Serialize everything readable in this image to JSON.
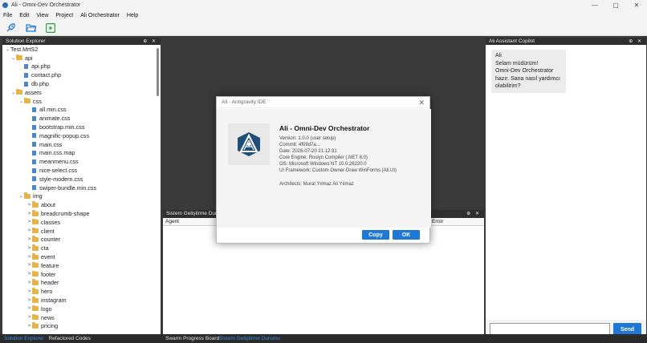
{
  "window": {
    "title": "Ali - Omni-Dev Orchestrator",
    "controls": [
      "—",
      "▢",
      "✕"
    ]
  },
  "menu": [
    "File",
    "Edit",
    "View",
    "Project",
    "Ali Orchestrator",
    "Help"
  ],
  "toolbar": {
    "icons": [
      "rocket-icon",
      "open-folder-icon",
      "run-icon"
    ],
    "accent": "#1e78d4",
    "run_color": "#2ea043"
  },
  "solution_explorer": {
    "title": "Solution Explorer",
    "header_icons": "⊕ ✕",
    "root": "Test.MrtS2",
    "rows": [
      {
        "label": "api",
        "type": "folder",
        "level": 1,
        "arrow": "⌄"
      },
      {
        "label": "api.php",
        "type": "file",
        "level": 2,
        "arrow": ""
      },
      {
        "label": "contact.php",
        "type": "file",
        "level": 2,
        "arrow": ""
      },
      {
        "label": "db.php",
        "type": "file",
        "level": 2,
        "arrow": ""
      },
      {
        "label": "assets",
        "type": "folder",
        "level": 1,
        "arrow": "⌄"
      },
      {
        "label": "css",
        "type": "folder",
        "level": 2,
        "arrow": "⌄"
      },
      {
        "label": "all.min.css",
        "type": "file",
        "level": 3,
        "arrow": ""
      },
      {
        "label": "animate.css",
        "type": "file",
        "level": 3,
        "arrow": ""
      },
      {
        "label": "bootstrap.min.css",
        "type": "file",
        "level": 3,
        "arrow": ""
      },
      {
        "label": "magnific-popup.css",
        "type": "file",
        "level": 3,
        "arrow": ""
      },
      {
        "label": "main.css",
        "type": "file",
        "level": 3,
        "arrow": ""
      },
      {
        "label": "main.css.map",
        "type": "file",
        "level": 3,
        "arrow": ""
      },
      {
        "label": "meanmenu.css",
        "type": "file",
        "level": 3,
        "arrow": ""
      },
      {
        "label": "nice-select.css",
        "type": "file",
        "level": 3,
        "arrow": ""
      },
      {
        "label": "style-modern.css",
        "type": "file",
        "level": 3,
        "arrow": ""
      },
      {
        "label": "swiper-bundle.min.css",
        "type": "file",
        "level": 3,
        "arrow": ""
      },
      {
        "label": "img",
        "type": "folder",
        "level": 2,
        "arrow": "⌄"
      },
      {
        "label": "about",
        "type": "folder",
        "level": 3,
        "arrow": ">"
      },
      {
        "label": "breadcrumb-shape",
        "type": "folder",
        "level": 3,
        "arrow": ">"
      },
      {
        "label": "classes",
        "type": "folder",
        "level": 3,
        "arrow": ">"
      },
      {
        "label": "client",
        "type": "folder",
        "level": 3,
        "arrow": ">"
      },
      {
        "label": "counter",
        "type": "folder",
        "level": 3,
        "arrow": ">"
      },
      {
        "label": "cta",
        "type": "folder",
        "level": 3,
        "arrow": ">"
      },
      {
        "label": "event",
        "type": "folder",
        "level": 3,
        "arrow": ">"
      },
      {
        "label": "feature",
        "type": "folder",
        "level": 3,
        "arrow": ">"
      },
      {
        "label": "footer",
        "type": "folder",
        "level": 3,
        "arrow": ">"
      },
      {
        "label": "header",
        "type": "folder",
        "level": 3,
        "arrow": ">"
      },
      {
        "label": "hero",
        "type": "folder",
        "level": 3,
        "arrow": ">"
      },
      {
        "label": "instagram",
        "type": "folder",
        "level": 3,
        "arrow": ">"
      },
      {
        "label": "logo",
        "type": "folder",
        "level": 3,
        "arrow": ">"
      },
      {
        "label": "news",
        "type": "folder",
        "level": 3,
        "arrow": ">"
      },
      {
        "label": "pricing",
        "type": "folder",
        "level": 3,
        "arrow": ">"
      }
    ]
  },
  "bottom_panel": {
    "title": "Sistem Geliştirme Durumu",
    "header_icons": "⊕ ✕",
    "columns": [
      "Agent",
      "Error"
    ]
  },
  "copilot": {
    "title": "Ali Assistant Copilot",
    "header_icons": "⊕ ✕",
    "message": "Ali\nSelam müdürüm!\nOmni-Dev Orchestrator\nhazır. Sana nasıl yardımcı\nolabilirim?",
    "input_value": "",
    "send_label": "Send"
  },
  "statusbar": {
    "left_tabs": [
      "Solution Explorer",
      "Refactored Codes"
    ],
    "center_tabs": [
      "Swarm Progress Board",
      "Sistem Geliştirme Durumu"
    ]
  },
  "about_dialog": {
    "window_title": "Ali - Antigravity IDE",
    "close": "✕",
    "heading": "Ali - Omni-Dev Orchestrator",
    "info_lines": [
      "Version: 1.0.0 (user setup)",
      "Commit: 4f09d7a...",
      "Date: 2026-07-20 21:12:31",
      "Core Engine: Roslyn Compiler (.NET 8.0)",
      "OS: Microsoft Windows NT 10.0.26220.0",
      "UI Framework: Custom Owner-Draw WinForms (Ali.UI)"
    ],
    "architects": "Architects: Murat Yılmaz  Ali Yılmaz",
    "copy_label": "Copy",
    "ok_label": "OK",
    "logo_icon": "triangle-logo-icon"
  }
}
